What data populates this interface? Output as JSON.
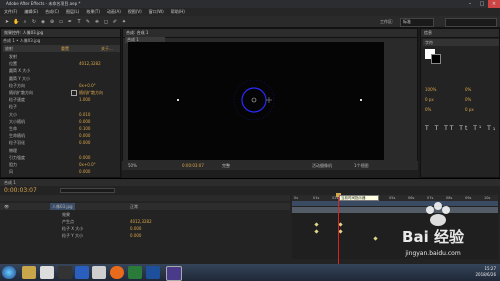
{
  "window": {
    "title": "Adobe After Effects - 未命名项目.aep *"
  },
  "menu": [
    "文件(F)",
    "编辑(E)",
    "合成(C)",
    "图层(L)",
    "效果(T)",
    "动画(A)",
    "视图(V)",
    "窗口(W)",
    "帮助(H)"
  ],
  "toolbar": {
    "workspace_label": "工作区:",
    "workspace_value": "标准",
    "search_placeholder": "搜索帮助"
  },
  "effects_panel": {
    "tab": "效果控件: 人像03.jpg",
    "header": "合成 1 • 人像03.jpg",
    "fx_name": "放射",
    "fx_reset": "重置",
    "fx_about": "关于...",
    "rows": [
      {
        "label": "发射",
        "value": ""
      },
      {
        "label": "位置",
        "value": "4012,3282"
      },
      {
        "label": "圆筒 X 大小",
        "value": ""
      },
      {
        "label": "圆筒 Y 大小",
        "value": ""
      },
      {
        "label": "粒子方向",
        "value": "0x+0.0°"
      },
      {
        "label": "随机扩散方向",
        "value": "随机扩散方向",
        "checkbox": true
      },
      {
        "label": "粒子速度",
        "value": "1.000"
      },
      {
        "label": "粒子",
        "value": ""
      },
      {
        "label": "大小",
        "value": "0.010"
      },
      {
        "label": "大小随机",
        "value": "0.000"
      },
      {
        "label": "生命",
        "value": "0.100"
      },
      {
        "label": "生命随机",
        "value": "0.000"
      },
      {
        "label": "粒子羽化",
        "value": "0.000"
      },
      {
        "label": "物理",
        "value": ""
      },
      {
        "label": "引力强度",
        "value": "0.000"
      },
      {
        "label": "阻力",
        "value": "0x+0.0°"
      },
      {
        "label": "风",
        "value": "0.000"
      }
    ]
  },
  "viewer": {
    "tab": "合成: 合成 1",
    "sub_tab": "合成 1",
    "zoom": "50%",
    "time": "0:00:03:07",
    "quality": "完整",
    "view": "活动摄像机",
    "views": "1个视图"
  },
  "right_panel": {
    "tab": "信息",
    "tab2": "字符",
    "font_size": "100%",
    "tracking": "0%",
    "values": [
      "0 px",
      "0%",
      "0%",
      "0 px"
    ]
  },
  "timeline": {
    "tab": "合成 1",
    "current_time": "0:00:03:07",
    "tooltip": "当前时间指示器",
    "layer_name": "人像03.jpg",
    "layer_mode": "正常",
    "sub_rows": [
      {
        "label": "效果",
        "value": ""
      },
      {
        "label": "产生点",
        "value": "4012,3282"
      },
      {
        "label": "粒子 X 大小",
        "value": "0.000"
      },
      {
        "label": "粒子 Y 大小",
        "value": "0.000"
      }
    ],
    "ruler": [
      "0s",
      "01s",
      "02s",
      "03s",
      "04s",
      "05s",
      "06s",
      "07s",
      "08s",
      "09s",
      "10s"
    ]
  },
  "watermark": {
    "logo": "Bai 经验",
    "url": "jingyan.baidu.com"
  },
  "taskbar": {
    "time": "15:27",
    "date": "2018/6/26"
  },
  "colors": {
    "accent": "#d9a64a",
    "playhead": "#d22",
    "taskbar": "#2a3646"
  }
}
